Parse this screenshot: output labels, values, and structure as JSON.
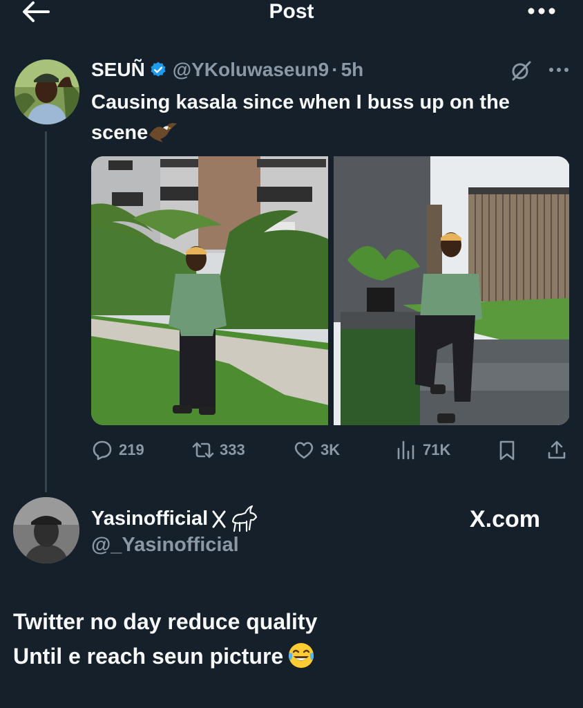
{
  "header": {
    "title": "Post"
  },
  "tweet": {
    "author_name": "SEUÑ",
    "handle": "@YKoluwaseun9",
    "separator": "·",
    "time": "5h",
    "text": "Causing kasala since when I buss up on the scene"
  },
  "stats": {
    "replies": "219",
    "reposts": "333",
    "likes": "3K",
    "views": "71K"
  },
  "reply": {
    "name": "Yasinofficial",
    "handle": "@_Yasinofficial",
    "watermark": "X.com",
    "line1": "Twitter no day reduce quality",
    "line2": "Until e reach seun picture"
  },
  "icons": [
    "back-arrow-icon",
    "more-icon",
    "verified-icon",
    "grok-icon",
    "eagle-emoji-icon",
    "reply-icon",
    "repost-icon",
    "like-icon",
    "views-icon",
    "bookmark-icon",
    "share-icon",
    "x-logo-icon",
    "goat-emoji-icon",
    "laughing-emoji-icon"
  ],
  "colors": {
    "background": "#15202b",
    "text": "#f7f9f9",
    "secondary": "#8b98a5",
    "verified": "#1d9bf0",
    "divider": "#38444d"
  }
}
